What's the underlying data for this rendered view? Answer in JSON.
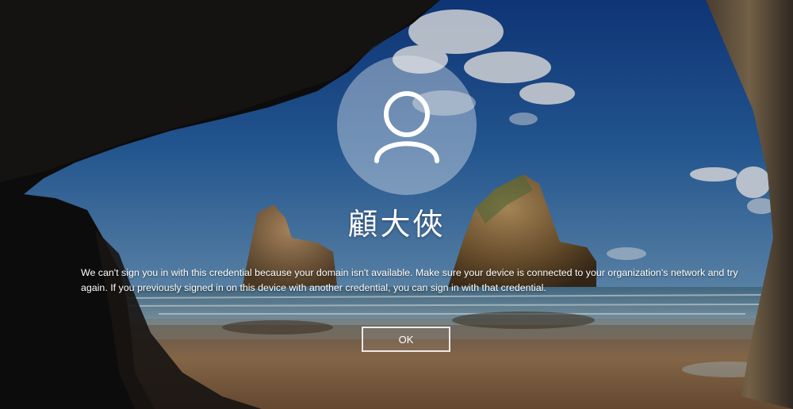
{
  "lock_screen": {
    "user_icon": "user-icon",
    "username": "顧大俠",
    "message": "We can't sign you in with this credential because your domain isn't available. Make sure your device is connected to your organization's network and try again. If you previously signed in on this device with another credential, you can sign in with that credential.",
    "ok_label": "OK"
  },
  "colors": {
    "sky": "#1e4f8f",
    "sea": "#6e93aa",
    "sand": "#9a7750",
    "cave": "#141210",
    "text": "#ffffff"
  }
}
